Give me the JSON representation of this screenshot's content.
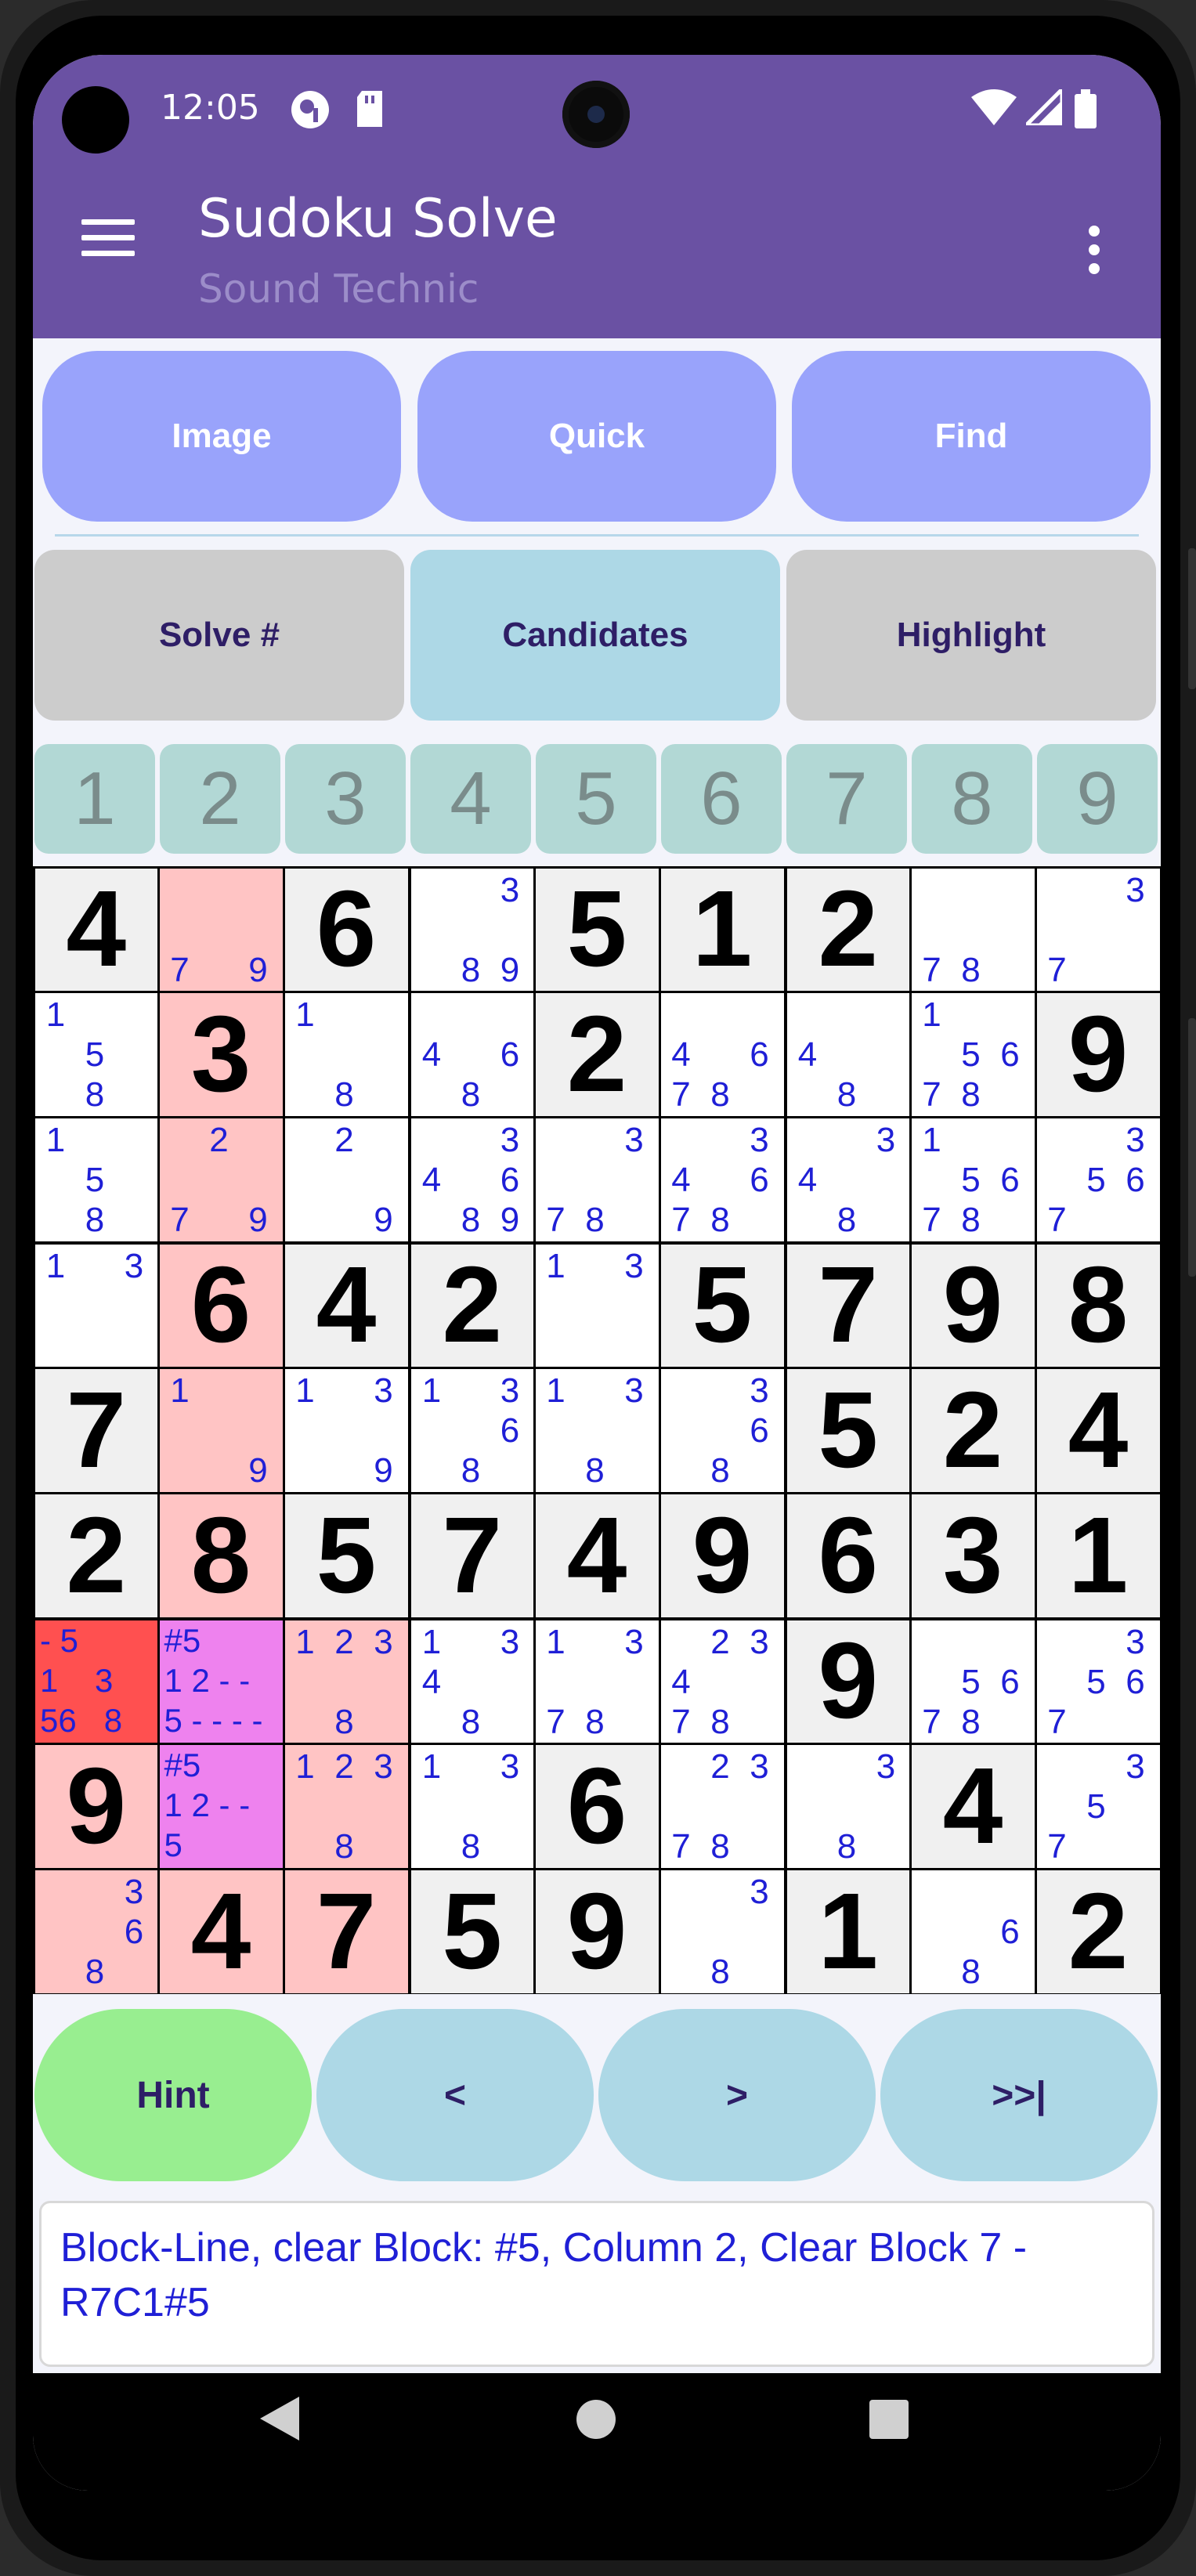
{
  "status": {
    "time": "12:05"
  },
  "app": {
    "title": "Sudoku Solve",
    "subtitle": "Sound Technic"
  },
  "toolbar": {
    "image": "Image",
    "quick": "Quick",
    "find": "Find"
  },
  "modes": {
    "solve": "Solve #",
    "candidates": "Candidates",
    "highlight": "Highlight"
  },
  "digits": [
    "1",
    "2",
    "3",
    "4",
    "5",
    "6",
    "7",
    "8",
    "9"
  ],
  "colors": {
    "appbar": "#6a51a3",
    "top_button": "#99a3fb",
    "selected_mode": "#add8e6",
    "mode_gray": "#cccccc",
    "given_cell": "#f0f0f0",
    "highlight": "#ffc4c4",
    "hint_cell": "#ff5050",
    "focus_cell": "#ee82ee",
    "hint_button": "#98ee90"
  },
  "grid": {
    "rows": [
      [
        {
          "v": "4",
          "bg": "gray"
        },
        {
          "c": [
            7,
            9
          ],
          "bg": "pink"
        },
        {
          "v": "6",
          "bg": "gray"
        },
        {
          "c": [
            3,
            8,
            9
          ]
        },
        {
          "v": "5",
          "bg": "gray"
        },
        {
          "v": "1",
          "bg": "gray"
        },
        {
          "v": "2",
          "bg": "gray"
        },
        {
          "c": [
            7,
            8
          ]
        },
        {
          "c": [
            3,
            7
          ]
        }
      ],
      [
        {
          "c": [
            1,
            5,
            8
          ]
        },
        {
          "v": "3",
          "bg": "pink"
        },
        {
          "c": [
            1,
            8
          ]
        },
        {
          "c": [
            4,
            6,
            8
          ]
        },
        {
          "v": "2",
          "bg": "gray"
        },
        {
          "c": [
            4,
            6,
            7,
            8
          ]
        },
        {
          "c": [
            4,
            8
          ]
        },
        {
          "c": [
            1,
            5,
            6,
            7,
            8
          ]
        },
        {
          "v": "9",
          "bg": "gray"
        }
      ],
      [
        {
          "c": [
            1,
            5,
            8
          ]
        },
        {
          "c": [
            2,
            7,
            9
          ],
          "bg": "pink"
        },
        {
          "c": [
            2,
            9
          ]
        },
        {
          "c": [
            3,
            4,
            6,
            8,
            9
          ]
        },
        {
          "c": [
            3,
            7,
            8
          ]
        },
        {
          "c": [
            3,
            4,
            6,
            7,
            8
          ]
        },
        {
          "c": [
            3,
            4,
            8
          ]
        },
        {
          "c": [
            1,
            5,
            6,
            7,
            8
          ]
        },
        {
          "c": [
            3,
            5,
            6,
            7
          ]
        }
      ],
      [
        {
          "c": [
            1,
            3
          ]
        },
        {
          "v": "6",
          "bg": "pink"
        },
        {
          "v": "4",
          "bg": "gray"
        },
        {
          "v": "2",
          "bg": "gray"
        },
        {
          "c": [
            1,
            3
          ]
        },
        {
          "v": "5",
          "bg": "gray"
        },
        {
          "v": "7",
          "bg": "gray"
        },
        {
          "v": "9",
          "bg": "gray"
        },
        {
          "v": "8",
          "bg": "gray"
        }
      ],
      [
        {
          "v": "7",
          "bg": "gray"
        },
        {
          "c": [
            1,
            9
          ],
          "bg": "pink"
        },
        {
          "c": [
            1,
            3,
            9
          ]
        },
        {
          "c": [
            1,
            3,
            6,
            8
          ]
        },
        {
          "c": [
            1,
            3,
            8
          ]
        },
        {
          "c": [
            3,
            6,
            8
          ]
        },
        {
          "v": "5",
          "bg": "gray"
        },
        {
          "v": "2",
          "bg": "gray"
        },
        {
          "v": "4",
          "bg": "gray"
        }
      ],
      [
        {
          "v": "2",
          "bg": "gray"
        },
        {
          "v": "8",
          "bg": "pink"
        },
        {
          "v": "5",
          "bg": "gray"
        },
        {
          "v": "7",
          "bg": "gray"
        },
        {
          "v": "4",
          "bg": "gray"
        },
        {
          "v": "9",
          "bg": "gray"
        },
        {
          "v": "6",
          "bg": "gray"
        },
        {
          "v": "3",
          "bg": "gray"
        },
        {
          "v": "1",
          "bg": "gray"
        }
      ],
      [
        {
          "n": [
            "- 5",
            "1    3",
            "56   8"
          ],
          "bg": "red"
        },
        {
          "n": [
            "#5",
            "1 2 - -",
            "5 - - - -"
          ],
          "bg": "violet"
        },
        {
          "c": [
            1,
            2,
            3,
            8
          ],
          "bg": "pink"
        },
        {
          "c": [
            1,
            3,
            4,
            8
          ]
        },
        {
          "c": [
            1,
            3,
            7,
            8
          ]
        },
        {
          "c": [
            2,
            3,
            4,
            7,
            8
          ]
        },
        {
          "v": "9",
          "bg": "gray"
        },
        {
          "c": [
            5,
            6,
            7,
            8
          ]
        },
        {
          "c": [
            3,
            5,
            6,
            7
          ]
        }
      ],
      [
        {
          "v": "9",
          "bg": "pink"
        },
        {
          "n": [
            "#5",
            "1 2 - -",
            "5"
          ],
          "bg": "violet"
        },
        {
          "c": [
            1,
            2,
            3,
            8
          ],
          "bg": "pink"
        },
        {
          "c": [
            1,
            3,
            8
          ]
        },
        {
          "v": "6",
          "bg": "gray"
        },
        {
          "c": [
            2,
            3,
            7,
            8
          ]
        },
        {
          "c": [
            3,
            8
          ]
        },
        {
          "v": "4",
          "bg": "gray"
        },
        {
          "c": [
            3,
            5,
            7
          ]
        }
      ],
      [
        {
          "c": [
            3,
            6,
            8
          ],
          "bg": "pink"
        },
        {
          "v": "4",
          "bg": "pink"
        },
        {
          "v": "7",
          "bg": "pink"
        },
        {
          "v": "5",
          "bg": "gray"
        },
        {
          "v": "9",
          "bg": "gray"
        },
        {
          "c": [
            3,
            8
          ]
        },
        {
          "v": "1",
          "bg": "gray"
        },
        {
          "c": [
            6,
            8
          ]
        },
        {
          "v": "2",
          "bg": "gray"
        }
      ]
    ]
  },
  "nav": {
    "hint": "Hint",
    "prev": "<",
    "next": ">",
    "end": ">>|"
  },
  "message": "Block-Line, clear Block: #5, Column 2, Clear Block 7 -R7C1#5"
}
